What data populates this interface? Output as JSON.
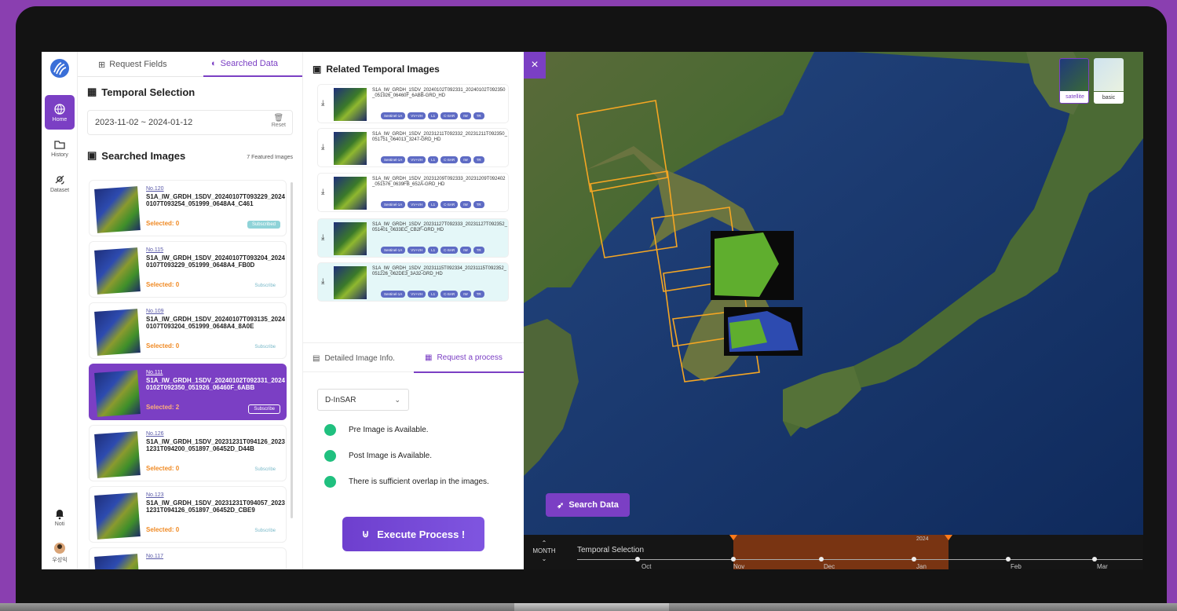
{
  "nav": {
    "items": [
      {
        "label": "Home",
        "icon": "globe-icon"
      },
      {
        "label": "History",
        "icon": "folder-icon"
      },
      {
        "label": "Dataset",
        "icon": "satellite-icon"
      }
    ],
    "bottom": [
      {
        "label": "Noti",
        "icon": "bell-icon"
      },
      {
        "label": "우성익",
        "icon": "avatar"
      }
    ]
  },
  "panel_tabs": {
    "request_fields": "Request Fields",
    "searched_data": "Searched Data"
  },
  "temporal": {
    "title": "Temporal Selection",
    "range": "2023-11-02 ~ 2024-01-12",
    "reset": "Reset"
  },
  "searched": {
    "title": "Searched Images",
    "featured": "7 Featured Images",
    "cards": [
      {
        "no": "No.120",
        "name": "S1A_IW_GRDH_1SDV_20240107T093229_20240107T093254_051999_0648A4_C461",
        "selected": "Selected: 0",
        "subscribe": "Subscribed"
      },
      {
        "no": "No.115",
        "name": "S1A_IW_GRDH_1SDV_20240107T093204_20240107T093229_051999_0648A4_FB0D",
        "selected": "Selected: 0",
        "subscribe": "Subscribe"
      },
      {
        "no": "No.109",
        "name": "S1A_IW_GRDH_1SDV_20240107T093135_20240107T093204_051999_0648A4_8A0E",
        "selected": "Selected: 0",
        "subscribe": "Subscribe"
      },
      {
        "no": "No.111",
        "name": "S1A_IW_GRDH_1SDV_20240102T092331_20240102T092350_051926_06460F_6ABB",
        "selected": "Selected: 2",
        "subscribe": "Subscribe"
      },
      {
        "no": "No.126",
        "name": "S1A_IW_GRDH_1SDV_20231231T094126_20231231T094200_051897_06452D_D44B",
        "selected": "Selected: 0",
        "subscribe": "Subscribe"
      },
      {
        "no": "No.123",
        "name": "S1A_IW_GRDH_1SDV_20231231T094057_20231231T094126_051897_06452D_CBE9",
        "selected": "Selected: 0",
        "subscribe": "Subscribe"
      },
      {
        "no": "No.117",
        "name": "",
        "selected": "",
        "subscribe": ""
      }
    ]
  },
  "related": {
    "title": "Related Temporal Images",
    "tags": [
      "Sentinel-1A",
      "VV+VH",
      "L1",
      "C-SAR",
      "IW",
      "TR"
    ],
    "items": [
      {
        "name": "S1A_IW_GRDH_1SDV_20240102T092331_20240102T092350_051926_06460F_6ABB-GRD_HD"
      },
      {
        "name": "S1A_IW_GRDH_1SDV_20231211T092332_20231211T092350_051751_064013_3247-GRD_HD"
      },
      {
        "name": "S1A_IW_GRDH_1SDV_20231209T092333_20231209T092402_051576_0639FB_652A-GRD_HD"
      },
      {
        "name": "S1A_IW_GRDH_1SDV_20231127T092333_20231127T092352_051401_0633EC_CB2F-GRD_HD"
      },
      {
        "name": "S1A_IW_GRDH_1SDV_20231115T092334_20231115T092352_051226_062DE3_3A32-GRD_HD"
      }
    ]
  },
  "process": {
    "tab_detail": "Detailed Image Info.",
    "tab_request": "Request a process",
    "select_value": "D-InSAR",
    "checks": [
      "Pre Image is Available.",
      "Post Image is Available.",
      "There is sufficient overlap in the images."
    ],
    "execute": "Execute Process !",
    "check_color": "#20c07f"
  },
  "map": {
    "layers": [
      "satellite",
      "basic"
    ],
    "search_button": "Search Data",
    "close": "×"
  },
  "timeline": {
    "month": "MONTH",
    "label": "Temporal Selection",
    "year": "2024",
    "months": [
      "Oct",
      "Nov",
      "Dec",
      "Jan",
      "Feb",
      "Mar"
    ]
  },
  "colors": {
    "accent": "#7b3fc4",
    "selected_text": "#f08a24",
    "range": "#8b3a12"
  }
}
